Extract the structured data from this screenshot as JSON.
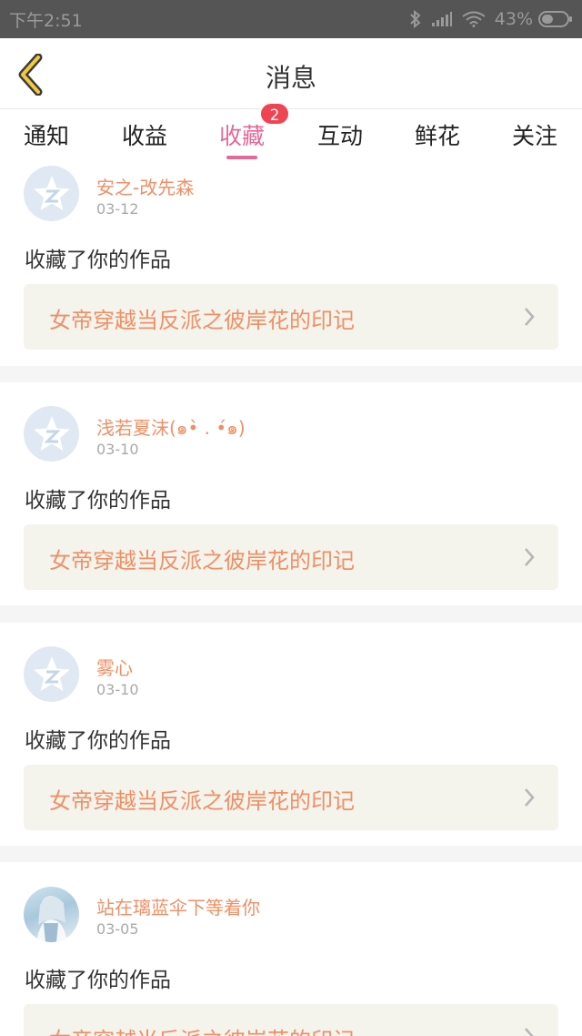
{
  "status_bar": {
    "time": "下午2:51",
    "battery": "43%"
  },
  "header": {
    "title": "消息"
  },
  "tabs": [
    {
      "label": "通知"
    },
    {
      "label": "收益"
    },
    {
      "label": "收藏",
      "badge": "2"
    },
    {
      "label": "互动"
    },
    {
      "label": "鲜花"
    },
    {
      "label": "关注"
    }
  ],
  "active_tab": "收藏",
  "colors": {
    "accent": "#e2699a",
    "username": "#ee9066",
    "badge": "#f04452",
    "work_box": "#f4f3ec"
  },
  "notifications": [
    {
      "user": "安之-改先森",
      "date": "03-12",
      "action": "收藏了你的作品",
      "work": "女帝穿越当反派之彼岸花的印记",
      "avatar": "default-avatar"
    },
    {
      "user": "浅若夏沫(๑•̀ . •́๑)",
      "date": "03-10",
      "action": "收藏了你的作品",
      "work": "女帝穿越当反派之彼岸花的印记",
      "avatar": "default-avatar"
    },
    {
      "user": "雾心",
      "date": "03-10",
      "action": "收藏了你的作品",
      "work": "女帝穿越当反派之彼岸花的印记",
      "avatar": "default-avatar"
    },
    {
      "user": "站在璃蓝伞下等着你",
      "date": "03-05",
      "action": "收藏了你的作品",
      "work": "女帝穿越当反派之彼岸花的印记",
      "avatar": "photo-avatar"
    }
  ]
}
